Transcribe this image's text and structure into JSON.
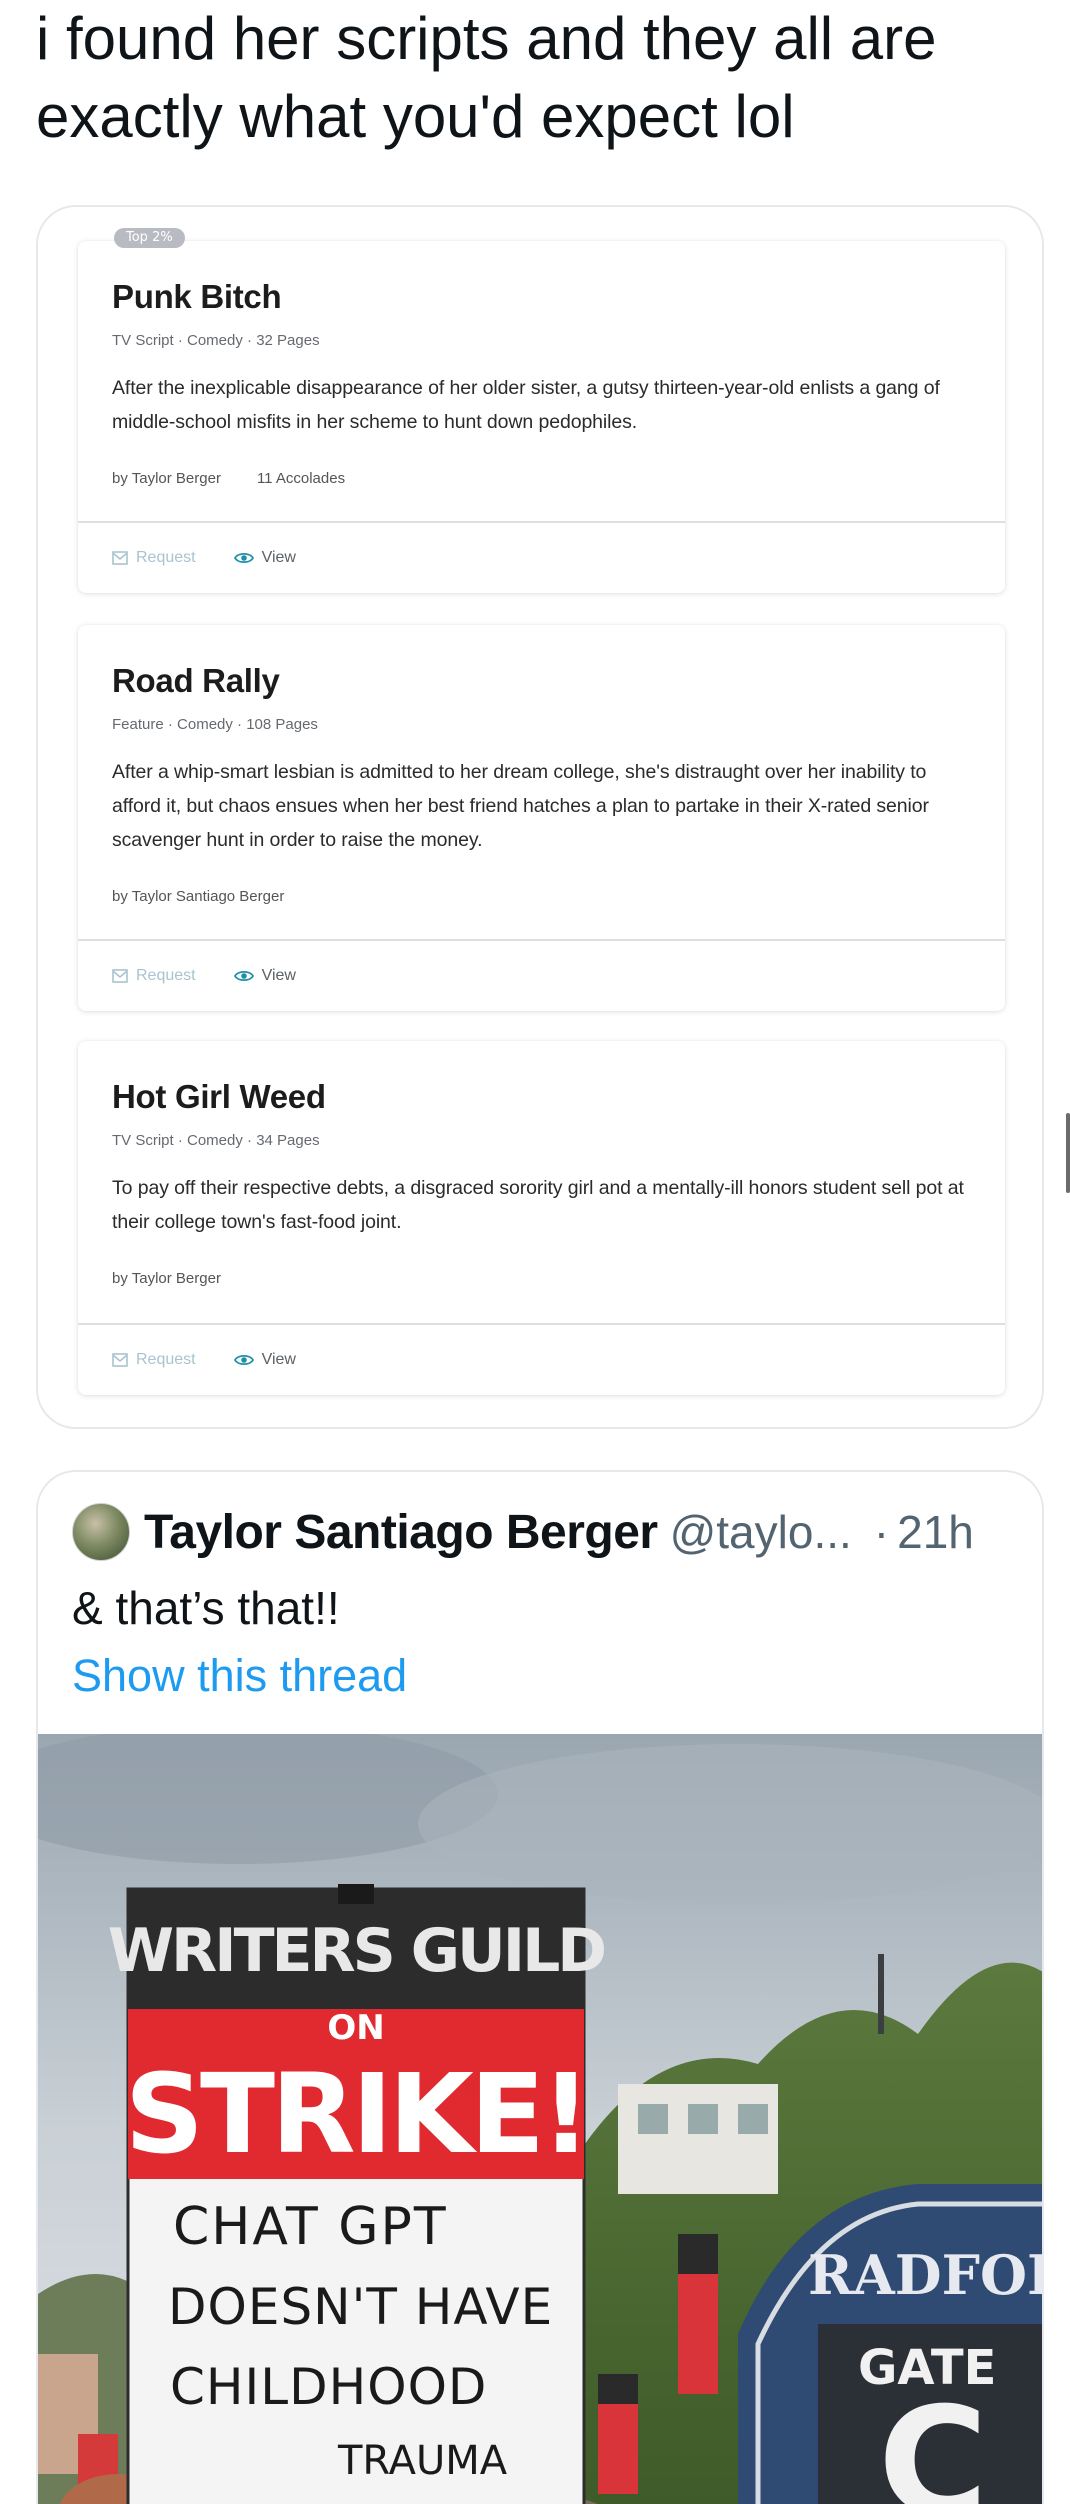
{
  "post": {
    "text": "i found her scripts and they all are\nexactly what you'd expect lol"
  },
  "quoted_page": {
    "scripts": [
      {
        "badge": "Top 2%",
        "title": "Punk Bitch",
        "meta": "TV Script · Comedy · 32 Pages",
        "description": "After the inexplicable disappearance of her older sister, a gutsy thirteen-year-old enlists a gang of middle-school misfits in her scheme to hunt down pedophiles.",
        "byline": "by Taylor Berger",
        "accolades": "11 Accolades",
        "request_label": "Request",
        "view_label": "View"
      },
      {
        "title": "Road Rally",
        "meta": "Feature · Comedy · 108 Pages",
        "description": "After a whip-smart lesbian is admitted to her dream college, she's distraught over her inability to afford it, but chaos ensues when her best friend hatches a plan to partake in their X-rated senior scavenger hunt in order to raise the money.",
        "byline": "by Taylor Santiago Berger",
        "request_label": "Request",
        "view_label": "View"
      },
      {
        "title": "Hot Girl Weed",
        "meta": "TV Script · Comedy · 34 Pages",
        "description": "To pay off their respective debts, a disgraced sorority girl and a mentally-ill honors student sell pot at their college town's fast-food joint.",
        "byline": "by Taylor Berger",
        "request_label": "Request",
        "view_label": "View"
      }
    ]
  },
  "tweet": {
    "name": "Taylor Santiago Berger",
    "handle": "@taylo...",
    "separator": "·",
    "time": "21h",
    "text": "& that’s that!!",
    "show_thread": "Show this thread",
    "photo": {
      "sign_line1": "WRITERS GUILD",
      "sign_line2": "ON",
      "sign_line3": "STRIKE!",
      "handwritten": [
        "CHAT GPT",
        "DOESN'T HAVE",
        "CHILDHOOD",
        "TRAUMA"
      ],
      "gate_sign_1": "RADFOR",
      "gate_sign_2": "GATE",
      "gate_sign_3": "C"
    }
  },
  "colors": {
    "link": "#1d9bf0",
    "secondary_text": "#536471",
    "strike_red": "#e02a2f",
    "request_disabled": "#a9c4cf"
  }
}
